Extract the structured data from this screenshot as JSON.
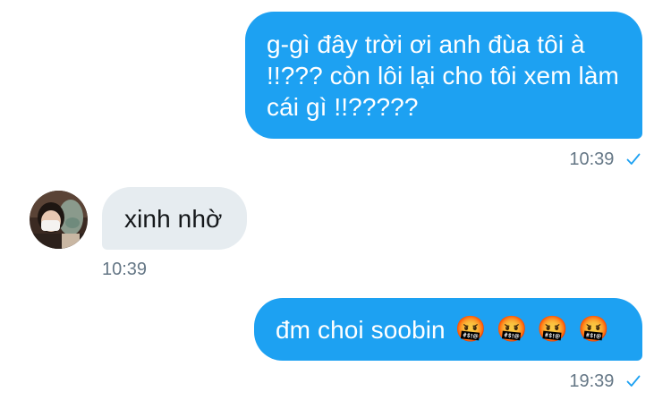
{
  "conversation": {
    "messages": [
      {
        "direction": "outgoing",
        "text": "g-gì đây trời ơi anh đùa tôi à !!??? còn lôi lại cho tôi xem làm cái gì !!?????",
        "time": "10:39",
        "status_icon": "check-icon"
      },
      {
        "direction": "incoming",
        "text": "xinh nhờ",
        "time": "10:39",
        "avatar_icon": "user-avatar"
      },
      {
        "direction": "outgoing",
        "text": "đm choi soobin",
        "emoji": [
          "🤬",
          "🤬",
          "🤬",
          "🤬"
        ],
        "time": "19:39",
        "status_icon": "check-icon"
      }
    ]
  },
  "colors": {
    "outgoing_bubble": "#1da1f2",
    "incoming_bubble": "#e6ecf0",
    "timestamp": "#657786",
    "check": "#1da1f2"
  }
}
